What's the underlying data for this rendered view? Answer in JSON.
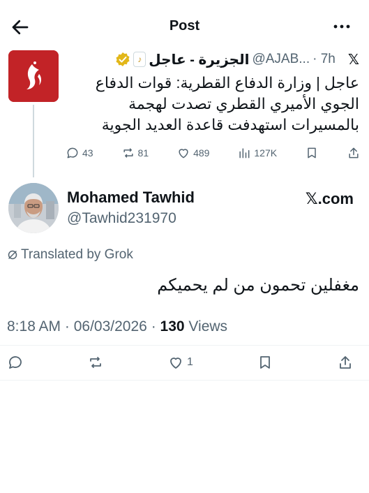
{
  "topbar": {
    "title": "Post"
  },
  "parent_tweet": {
    "display_name": "الجزيرة - عاجل",
    "handle": "@AJAB...",
    "time": "· 7h",
    "text": "عاجل | وزارة الدفاع القطرية: قوات الدفاع الجوي الأميري القطري تصدت لهجمة بالمسيرات استهدفت قاعدة العديد الجوية",
    "replies": "43",
    "reposts": "81",
    "likes": "489",
    "views": "127K"
  },
  "main_tweet": {
    "display_name": "Mohamed Tawhid",
    "handle": "@Tawhid231970",
    "external_link": "𝕏.com",
    "translated_label": "Translated by Grok",
    "text": "مغفلين تحمون من لم يحميكم",
    "time": "8:18 AM",
    "date": "06/03/2026",
    "views_count": "130",
    "views_label": "Views",
    "likes": "1"
  },
  "colors": {
    "brand_red": "#c22327",
    "text_primary": "#0f1419",
    "text_secondary": "#536471",
    "verified_gold": "#e2b719"
  }
}
